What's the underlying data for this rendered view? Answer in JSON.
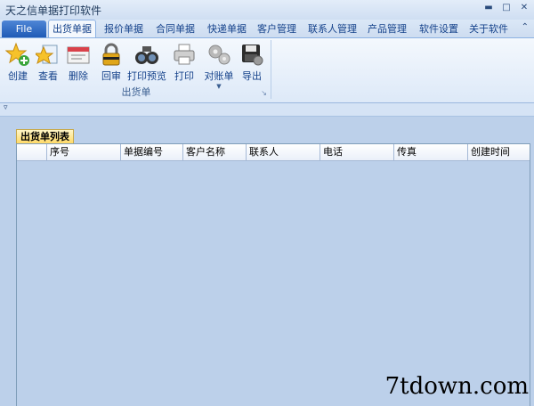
{
  "window": {
    "title": "天之信单据打印软件"
  },
  "tabs": {
    "file": "File",
    "items": [
      "出货单据",
      "报价单据",
      "合同单据",
      "快递单据",
      "客户管理",
      "联系人管理",
      "产品管理",
      "软件设置",
      "关于软件"
    ]
  },
  "ribbon": {
    "buttons": [
      "创建",
      "查看",
      "删除",
      "回审",
      "打印预览",
      "打印",
      "对账单",
      "导出"
    ],
    "group_label": "出货单"
  },
  "document": {
    "tab_label": "出货单列表",
    "columns": [
      "序号",
      "单据编号",
      "客户名称",
      "联系人",
      "电话",
      "传真",
      "创建时间"
    ]
  },
  "watermark": "7tdown.com",
  "colors": {
    "accent": "#15428b",
    "file_button": "#1f5bb6",
    "doc_tab": "#ffd861"
  }
}
